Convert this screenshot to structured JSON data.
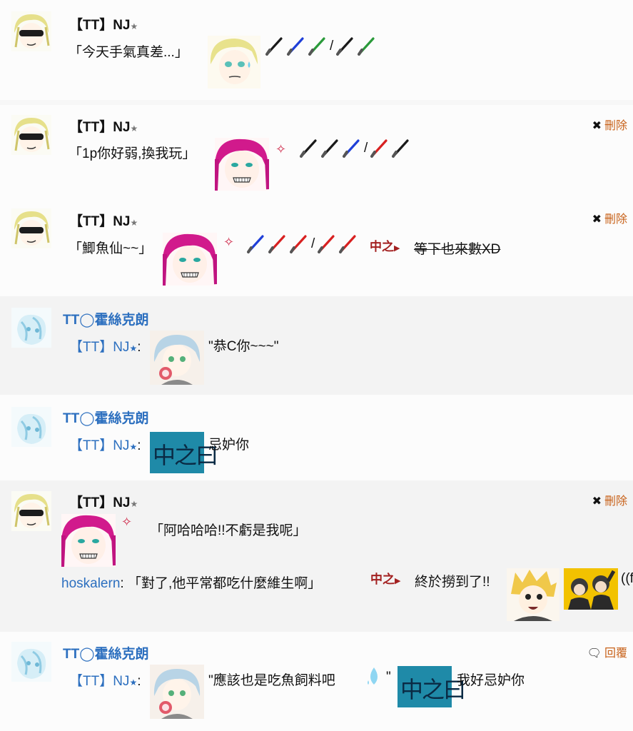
{
  "posts": [
    {
      "author": "【TT】NJ",
      "star": "★",
      "quote": "「今天手氣真差...」",
      "separator": "/"
    },
    {
      "author": "【TT】NJ",
      "star": "★",
      "quote": "「1p你好弱,換我玩」",
      "separator": "/",
      "action_icon": "✖",
      "action_label": "刪除"
    },
    {
      "author": "【TT】NJ",
      "star": "★",
      "quote": "「鯽魚仙~~」",
      "separator": "/",
      "badge": "中之",
      "strike_text": "等下也來數XD",
      "action_icon": "✖",
      "action_label": "刪除"
    },
    {
      "author": "TT◯霍絲克朗",
      "mention": "【TT】NJ",
      "star": "★",
      "colon": ":",
      "message": "\"恭C你~~~\""
    },
    {
      "author": "TT◯霍絲克朗",
      "mention": "【TT】NJ",
      "star": "★",
      "colon": ":",
      "tile_text": "中之曰",
      "message": "忌妒你"
    },
    {
      "author": "【TT】NJ",
      "star": "★",
      "quote": "「阿哈哈哈!!不虧是我呢」",
      "action_icon": "✖",
      "action_label": "刪除",
      "reply_user": "hoskalern",
      "reply_colon": ":",
      "reply_quote": "「對了,他平常都吃什麼維生啊」",
      "badge": "中之",
      "reply_tail": "終於撈到了!!",
      "reply_cut": "((f"
    },
    {
      "author": "TT◯霍絲克朗",
      "mention": "【TT】NJ",
      "star": "★",
      "colon": ":",
      "message_a": "\"應該也是吃魚飼料吧",
      "message_b": "\"",
      "tile_text": "中之曰",
      "message_c": "我好忌妒你",
      "action_icon": "💬",
      "action_label": "回覆"
    }
  ],
  "colors": {
    "link_blue": "#2c6fbf",
    "action_orange": "#c8621a",
    "tile_teal": "#1f8aa8",
    "sword_black": "#1a1a1a",
    "sword_blue": "#1f3fd8",
    "sword_green": "#2a9a3a",
    "sword_red": "#d82020"
  }
}
